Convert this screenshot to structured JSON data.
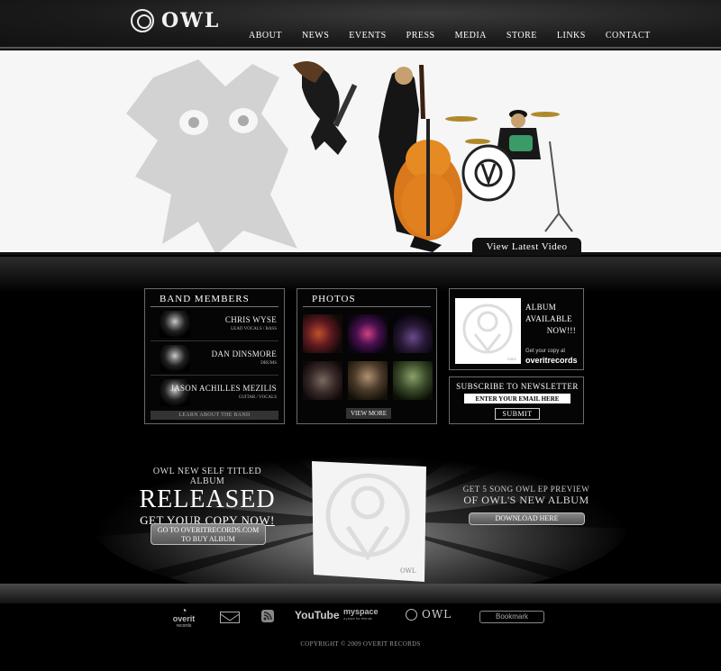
{
  "header": {
    "logo_text": "OWL",
    "nav": [
      "About",
      "News",
      "Events",
      "Press",
      "Media",
      "Store",
      "Links",
      "Contact"
    ]
  },
  "hero": {
    "video_button": "View Latest Video"
  },
  "members_panel": {
    "title": "Band Members",
    "members": [
      {
        "name": "Chris Wyse",
        "role": "Lead Vocals / Bass"
      },
      {
        "name": "Dan Dinsmore",
        "role": "Drums"
      },
      {
        "name": "Jason Achilles Mezilis",
        "role": "Guitar / Vocals"
      }
    ],
    "learn_button": "Learn About The Band"
  },
  "photos_panel": {
    "title": "Photos",
    "view_more": "View More"
  },
  "album_panel": {
    "line1": "Album",
    "line2": "Available",
    "line3": "Now!!!",
    "get_copy": "Get your copy at",
    "brand": "overitrecords",
    "cover_text": "OWL"
  },
  "newsletter": {
    "title": "Subscribe To Newsletter",
    "placeholder": "Enter Your Email Here",
    "submit": "Submit"
  },
  "promo": {
    "small": "Owl new self titled Album",
    "big": "Released",
    "sub_prefix": "Get Your Copy",
    "sub_link": "Now!",
    "buy_line1": "Go to OveritRecords.com",
    "buy_line2": "To Buy Album",
    "right_line1": "Get 5 Song Owl EP Preview",
    "right_line2": "Of Owl's New Album",
    "download_button": "Download Here",
    "cover_text": "OWL"
  },
  "footer": {
    "overit_label": "overit",
    "overit_sub": "records",
    "youtube": "YouTube",
    "myspace": "myspace",
    "myspace_sub": "a place for friends",
    "owl_label": "OWL",
    "bookmark": "Bookmark",
    "copyright": "Copyright © 2009 Overit Records"
  }
}
